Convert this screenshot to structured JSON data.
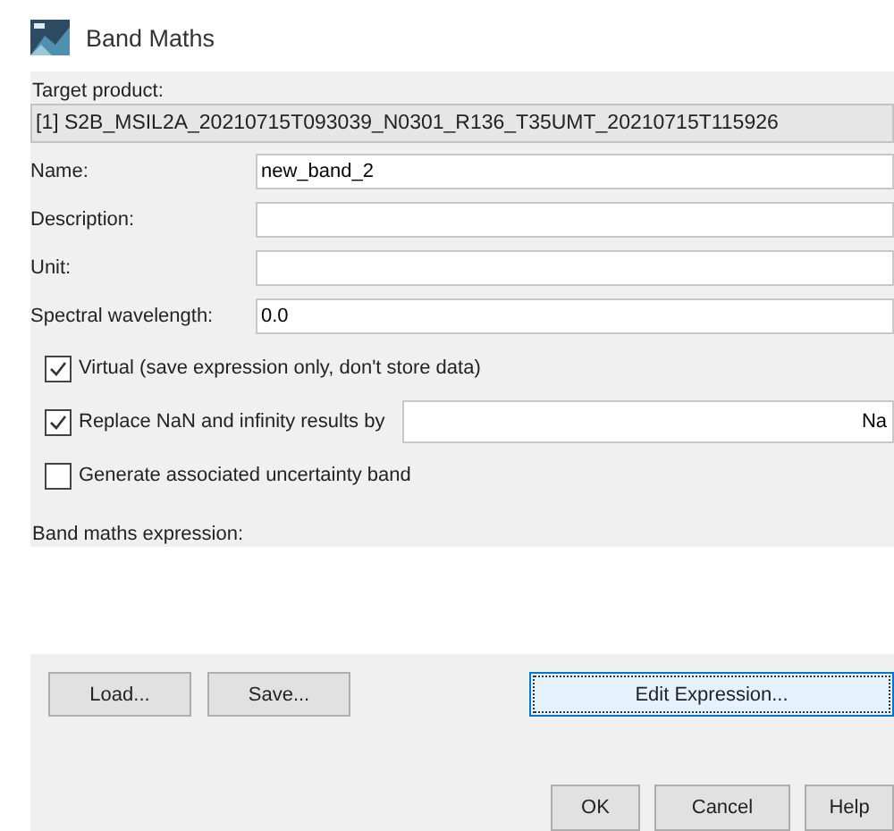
{
  "window": {
    "title": "Band Maths"
  },
  "target_product": {
    "label": "Target product:",
    "value": "[1] S2B_MSIL2A_20210715T093039_N0301_R136_T35UMT_20210715T115926"
  },
  "fields": [
    {
      "label": "Name:",
      "value": "new_band_2"
    },
    {
      "label": "Description:"
    },
    {
      "label": "Unit:"
    },
    {
      "label": "Spectral wavelength:",
      "value": "0.0"
    }
  ],
  "options": [
    {
      "kind": "checkbox",
      "label": "Virtual (save expression only, don't store data)",
      "checked": true
    },
    {
      "kind": "checkbox_field",
      "label": "Replace NaN and infinity results by",
      "checked": true,
      "value": "Na"
    },
    {
      "kind": "checkbox",
      "label": "Generate associated uncertainty band",
      "checked": false
    }
  ],
  "expression": {
    "label": "Band maths expression:"
  },
  "expression_buttons": [
    {
      "label": "Load...",
      "focused": false
    },
    {
      "label": "Save...",
      "focused": false
    },
    {
      "label": "Edit Expression...",
      "focused": true
    }
  ],
  "dialog_buttons": [
    "OK",
    "Cancel",
    "Help"
  ]
}
